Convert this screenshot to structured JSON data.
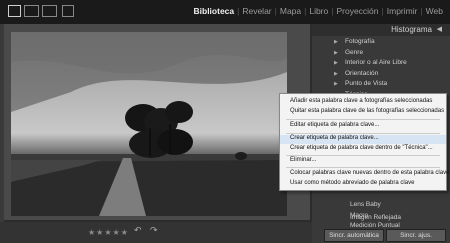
{
  "modules": [
    "Biblioteca",
    "Revelar",
    "Mapa",
    "Libro",
    "Proyección",
    "Imprimir",
    "Web"
  ],
  "active_module": "Biblioteca",
  "panel": {
    "title": "Histograma",
    "items": [
      "Fotografía",
      "Genre",
      "Interior o al Aire Libre",
      "Orientación",
      "Punto de Vista",
      "Técnica"
    ],
    "lower_items": [
      "Imagen Reflejada",
      "Lens Baby",
      "Macro",
      "Medición Puntual"
    ]
  },
  "context_menu": {
    "items": [
      "Añadir esta palabra clave a fotografías seleccionadas",
      "Quitar esta palabra clave de las fotografías seleccionadas",
      "Editar etiqueta de palabra clave...",
      "Crear etiqueta de palabra clave...",
      "Crear etiqueta de palabra clave dentro de \"Técnica\"...",
      "Eliminar...",
      "Colocar palabras clave nuevas dentro de esta palabra clave",
      "Usar como método abreviado de palabra clave"
    ],
    "highlighted_index": 3
  },
  "toolbar": {
    "stars": "★★★★★"
  },
  "buttons": {
    "sync_auto": "Sincr. automática",
    "sync_settings": "Sincr. ajus."
  },
  "colors": {
    "menu_highlight": "#d7e4f4",
    "active_module": "#f0f0f0"
  }
}
